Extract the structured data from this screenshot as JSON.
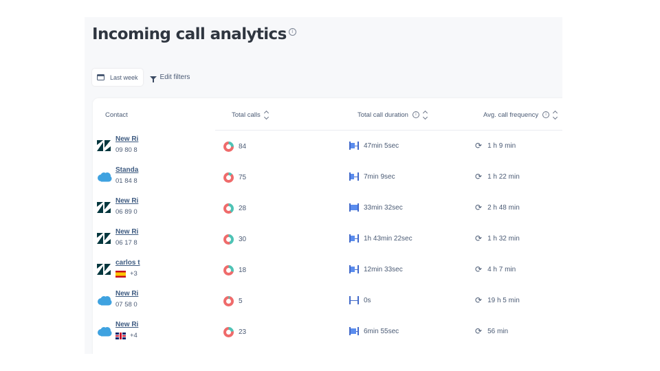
{
  "page": {
    "title": "Incoming call analytics",
    "info_icon": "info-icon"
  },
  "filters": {
    "date_label": "Last week",
    "date_icon": "calendar-icon",
    "edit_label": "Edit filters",
    "edit_icon": "filter-icon"
  },
  "table": {
    "headers": {
      "contact": "Contact",
      "total_calls": "Total calls",
      "total_duration": "Total call duration",
      "avg_frequency": "Avg. call frequency"
    },
    "rows": [
      {
        "source": "zendesk",
        "name": "New Ri",
        "number": "09 80 8",
        "flag": "",
        "calls": "84",
        "calls_share": 0.25,
        "duration": "47min 5sec",
        "duration_fill": 0.6,
        "frequency": "1 h 9 min"
      },
      {
        "source": "salesforce",
        "name": "Standa",
        "number": "01 84 8",
        "flag": "",
        "calls": "75",
        "calls_share": 0.12,
        "duration": "7min 9sec",
        "duration_fill": 0.5,
        "frequency": "1 h 22 min"
      },
      {
        "source": "zendesk",
        "name": "New Ri",
        "number": "06 89 0",
        "flag": "",
        "calls": "28",
        "calls_share": 0.4,
        "duration": "33min 32sec",
        "duration_fill": 1.0,
        "frequency": "2 h 48 min"
      },
      {
        "source": "zendesk",
        "name": "New Ri",
        "number": "06 17 8",
        "flag": "",
        "calls": "30",
        "calls_share": 0.45,
        "duration": "1h 43min 22sec",
        "duration_fill": 0.6,
        "frequency": "1 h 32 min"
      },
      {
        "source": "zendesk",
        "name": "carlos t",
        "number": "+3",
        "flag": "es",
        "calls": "18",
        "calls_share": 0.3,
        "duration": "12min 33sec",
        "duration_fill": 0.6,
        "frequency": "4 h 7 min"
      },
      {
        "source": "salesforce",
        "name": "New Ri",
        "number": "07 58 0",
        "flag": "",
        "calls": "5",
        "calls_share": 0.05,
        "duration": "0s",
        "duration_fill": 0.0,
        "frequency": "19 h 5 min"
      },
      {
        "source": "salesforce",
        "name": "New Ri",
        "number": "+4",
        "flag": "gb",
        "calls": "23",
        "calls_share": 0.22,
        "duration": "6min 55sec",
        "duration_fill": 0.8,
        "frequency": "56 min"
      }
    ]
  },
  "colors": {
    "calls_primary": "#ef6b6b",
    "calls_secondary": "#4ec3b5",
    "duration_bar": "#5b8def",
    "zendesk": "#03363d",
    "salesforce": "#3fa2e0"
  }
}
